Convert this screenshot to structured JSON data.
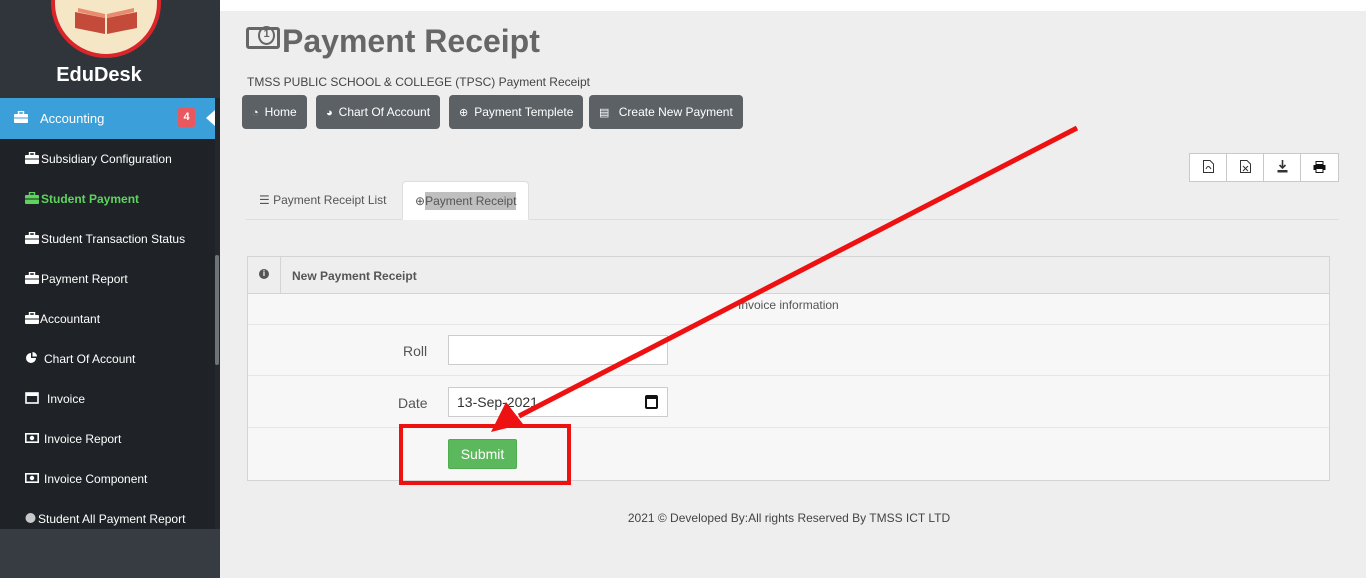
{
  "sidebar": {
    "brand": "EduDesk",
    "active_menu": {
      "icon": "briefcase-icon",
      "label": "Accounting",
      "badge": "4"
    },
    "items": [
      {
        "icon": "briefcase-icon",
        "label": "Subsidiary Configuration",
        "active": false
      },
      {
        "icon": "briefcase-icon",
        "label": "Student Payment",
        "active": true
      },
      {
        "icon": "briefcase-icon",
        "label": "Student Transaction Status",
        "active": false
      },
      {
        "icon": "briefcase-icon",
        "label": "Payment Report",
        "active": false
      },
      {
        "icon": "briefcase-icon",
        "label": "Accountant",
        "active": false
      },
      {
        "icon": "pie-chart-icon",
        "label": "Chart Of Account",
        "active": false
      },
      {
        "icon": "window-icon",
        "label": "Invoice",
        "active": false
      },
      {
        "icon": "money-icon",
        "label": "Invoice Report",
        "active": false
      },
      {
        "icon": "money-icon",
        "label": "Invoice Component",
        "active": false
      },
      {
        "icon": "circle-icon",
        "label": "Student All Payment Report",
        "active": false
      }
    ]
  },
  "header": {
    "title": "Payment Receipt",
    "subtitle": "TMSS PUBLIC SCHOOL & COLLEGE (TPSC) Payment Receipt"
  },
  "toolbar": {
    "buttons": [
      {
        "icon": "dashboard-icon",
        "label": "Home"
      },
      {
        "icon": "pie-chart-icon",
        "label": "Chart Of Account"
      },
      {
        "icon": "plus-circle-icon",
        "label": "Payment Templete"
      },
      {
        "icon": "list-alt-icon",
        "label": "Create New Payment"
      }
    ]
  },
  "export": [
    "pdf-icon",
    "excel-icon",
    "download-icon",
    "print-icon"
  ],
  "tabs": [
    {
      "icon": "list-icon",
      "label": "Payment Receipt List"
    },
    {
      "icon": "plus-circle-icon",
      "label": "Payment Receipt"
    }
  ],
  "panel": {
    "title": "New Payment Receipt",
    "section": "Invoice information",
    "roll_label": "Roll",
    "roll_value": "",
    "date_label": "Date",
    "date_value": "13-Sep-2021",
    "submit_label": "Submit"
  },
  "footer": "2021 © Developed By:All rights Reserved By TMSS ICT LTD",
  "colors": {
    "sidebar_bg": "#2b3035",
    "active_menu": "#3b9fd9",
    "active_submenu_text": "#5fd35f",
    "button_bg": "#5c6166",
    "submit": "#5cb85c",
    "annotation": "#ee1111"
  }
}
